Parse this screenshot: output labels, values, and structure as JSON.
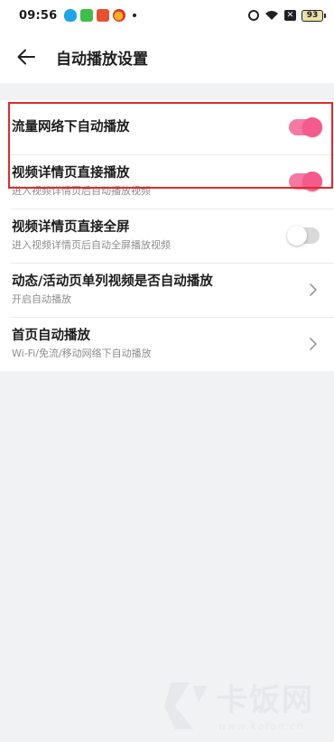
{
  "status_bar": {
    "time": "09:56",
    "battery": "93",
    "notification_icons": [
      "qq-icon",
      "wechat-icon",
      "app-icon",
      "weibo-icon"
    ],
    "status_icons": [
      "alarm-icon",
      "wifi-icon",
      "sim-off-icon",
      "battery-icon"
    ]
  },
  "header": {
    "title": "自动播放设置"
  },
  "settings": [
    {
      "title": "流量网络下自动播放",
      "subtitle": "",
      "control": "toggle",
      "state": true
    },
    {
      "title": "视频详情页直接播放",
      "subtitle": "进入视频详情页后自动播放视频",
      "control": "toggle",
      "state": true
    },
    {
      "title": "视频详情页直接全屏",
      "subtitle": "进入视频详情页后自动全屏播放视频",
      "control": "toggle",
      "state": false
    },
    {
      "title": "动态/活动页单列视频是否自动播放",
      "subtitle": "开启自动播放",
      "control": "chevron"
    },
    {
      "title": "首页自动播放",
      "subtitle": "Wi-Fi/免流/移动网络下自动播放",
      "control": "chevron"
    }
  ],
  "watermark": {
    "text": "卡饭网",
    "url": "www.kafan.cn"
  },
  "colors": {
    "toggle_on_track": "#f57aa3",
    "toggle_on_knob": "#f45a8d",
    "toggle_off_track": "#d9d9d9",
    "highlight_border": "#e02a2a",
    "page_background": "#f1f2f4"
  }
}
